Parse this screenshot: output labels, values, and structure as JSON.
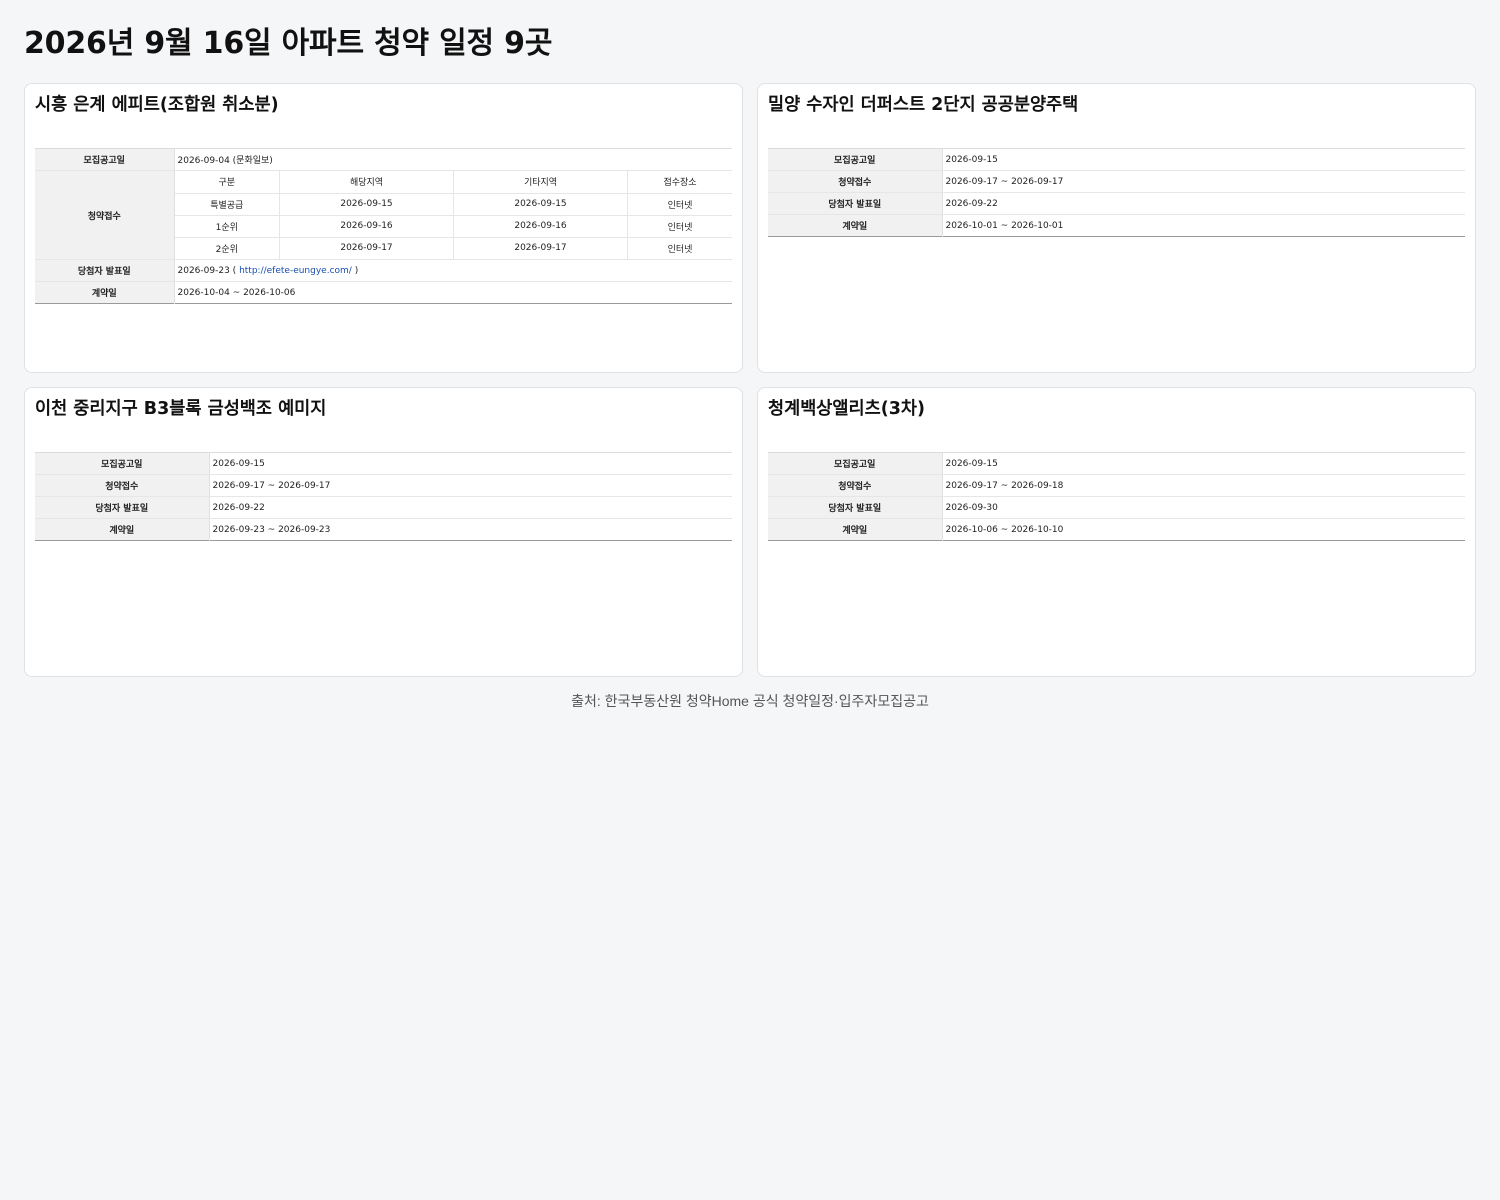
{
  "page": {
    "title": "2026년 9월 16일 아파트 청약 일정 9곳",
    "footer": "출처: 한국부동산원 청약Home 공식 청약일정·입주자모집공고"
  },
  "labels": {
    "notice": "모집공고일",
    "apply": "청약접수",
    "winner": "당첨자 발표일",
    "contract": "계약일"
  },
  "cards": [
    {
      "title": "시흥 은계 에피트(조합원 취소분)",
      "notice": "2026-09-04 (문화일보)",
      "apply_headers": [
        "구분",
        "해당지역",
        "기타지역",
        "접수장소"
      ],
      "apply_rows": [
        [
          "특별공급",
          "2026-09-15",
          "2026-09-15",
          "인터넷"
        ],
        [
          "1순위",
          "2026-09-16",
          "2026-09-16",
          "인터넷"
        ],
        [
          "2순위",
          "2026-09-17",
          "2026-09-17",
          "인터넷"
        ]
      ],
      "winner_date": "2026-09-23",
      "winner_prefix": "2026-09-23 (",
      "winner_link": "http://efete-eungye.com/",
      "winner_suffix": ")",
      "contract": "2026-10-04 ~ 2026-10-06"
    },
    {
      "title": "밀양 수자인 더퍼스트 2단지 공공분양주택",
      "notice": "2026-09-15",
      "apply": "2026-09-17 ~ 2026-09-17",
      "winner": "2026-09-22",
      "contract": "2026-10-01 ~ 2026-10-01"
    },
    {
      "title": "이천 중리지구 B3블록 금성백조 예미지",
      "notice": "2026-09-15",
      "apply": "2026-09-17 ~ 2026-09-17",
      "winner": "2026-09-22",
      "contract": "2026-09-23 ~ 2026-09-23"
    },
    {
      "title": "청계백상앨리츠(3차)",
      "notice": "2026-09-15",
      "apply": "2026-09-17 ~ 2026-09-18",
      "winner": "2026-09-30",
      "contract": "2026-10-06 ~ 2026-10-10"
    }
  ]
}
